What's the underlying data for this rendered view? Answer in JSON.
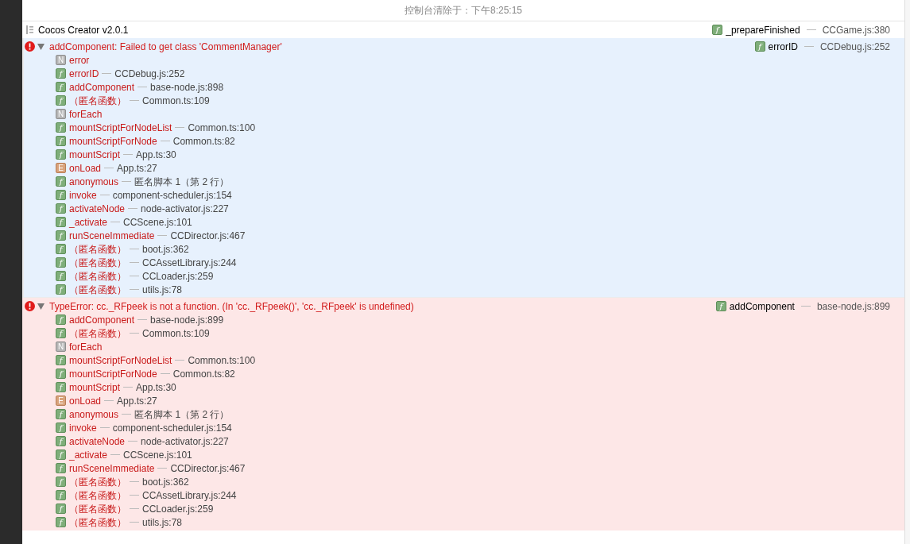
{
  "clear_notice": "控制台清除于：下午8:25:15",
  "messages": [
    {
      "kind": "log",
      "text": "Cocos Creator v2.0.1",
      "selected": false,
      "call_site": {
        "kind": "function",
        "badge": "f",
        "name": "_prepareFinished",
        "location": "CCGame.js:380"
      }
    },
    {
      "kind": "error",
      "text": "addComponent: Failed to get class 'CommentManager'",
      "selected": true,
      "expanded": true,
      "call_site": {
        "kind": "function",
        "badge": "f",
        "name": "errorID",
        "location": "CCDebug.js:252"
      },
      "frames": [
        {
          "kind": "native",
          "badge": "N",
          "name": "error"
        },
        {
          "kind": "function",
          "badge": "f",
          "name": "errorID",
          "location": "CCDebug.js:252"
        },
        {
          "kind": "function",
          "badge": "f",
          "name": "addComponent",
          "location": "base-node.js:898"
        },
        {
          "kind": "function",
          "badge": "f",
          "name": "（匿名函数）",
          "location": "Common.ts:109"
        },
        {
          "kind": "native",
          "badge": "N",
          "name": "forEach"
        },
        {
          "kind": "function",
          "badge": "f",
          "name": "mountScriptForNodeList",
          "location": "Common.ts:100"
        },
        {
          "kind": "function",
          "badge": "f",
          "name": "mountScriptForNode",
          "location": "Common.ts:82"
        },
        {
          "kind": "function",
          "badge": "f",
          "name": "mountScript",
          "location": "App.ts:30"
        },
        {
          "kind": "event",
          "badge": "E",
          "name": "onLoad",
          "location": "App.ts:27"
        },
        {
          "kind": "function",
          "badge": "f",
          "name": "anonymous",
          "location": "匿名脚本 1（第 2 行）"
        },
        {
          "kind": "function",
          "badge": "f",
          "name": "invoke",
          "location": "component-scheduler.js:154"
        },
        {
          "kind": "function",
          "badge": "f",
          "name": "activateNode",
          "location": "node-activator.js:227"
        },
        {
          "kind": "function",
          "badge": "f",
          "name": "_activate",
          "location": "CCScene.js:101"
        },
        {
          "kind": "function",
          "badge": "f",
          "name": "runSceneImmediate",
          "location": "CCDirector.js:467"
        },
        {
          "kind": "function",
          "badge": "f",
          "name": "（匿名函数）",
          "location": "boot.js:362"
        },
        {
          "kind": "function",
          "badge": "f",
          "name": "（匿名函数）",
          "location": "CCAssetLibrary.js:244"
        },
        {
          "kind": "function",
          "badge": "f",
          "name": "（匿名函数）",
          "location": "CCLoader.js:259"
        },
        {
          "kind": "function",
          "badge": "f",
          "name": "（匿名函数）",
          "location": "utils.js:78"
        }
      ]
    },
    {
      "kind": "error",
      "text": "TypeError: cc._RFpeek is not a function. (In 'cc._RFpeek()', 'cc._RFpeek' is undefined)",
      "selected": false,
      "expanded": true,
      "call_site": {
        "kind": "function",
        "badge": "f",
        "name": "addComponent",
        "location": "base-node.js:899"
      },
      "frames": [
        {
          "kind": "function",
          "badge": "f",
          "name": "addComponent",
          "location": "base-node.js:899"
        },
        {
          "kind": "function",
          "badge": "f",
          "name": "（匿名函数）",
          "location": "Common.ts:109"
        },
        {
          "kind": "native",
          "badge": "N",
          "name": "forEach"
        },
        {
          "kind": "function",
          "badge": "f",
          "name": "mountScriptForNodeList",
          "location": "Common.ts:100"
        },
        {
          "kind": "function",
          "badge": "f",
          "name": "mountScriptForNode",
          "location": "Common.ts:82"
        },
        {
          "kind": "function",
          "badge": "f",
          "name": "mountScript",
          "location": "App.ts:30"
        },
        {
          "kind": "event",
          "badge": "E",
          "name": "onLoad",
          "location": "App.ts:27"
        },
        {
          "kind": "function",
          "badge": "f",
          "name": "anonymous",
          "location": "匿名脚本 1（第 2 行）"
        },
        {
          "kind": "function",
          "badge": "f",
          "name": "invoke",
          "location": "component-scheduler.js:154"
        },
        {
          "kind": "function",
          "badge": "f",
          "name": "activateNode",
          "location": "node-activator.js:227"
        },
        {
          "kind": "function",
          "badge": "f",
          "name": "_activate",
          "location": "CCScene.js:101"
        },
        {
          "kind": "function",
          "badge": "f",
          "name": "runSceneImmediate",
          "location": "CCDirector.js:467"
        },
        {
          "kind": "function",
          "badge": "f",
          "name": "（匿名函数）",
          "location": "boot.js:362"
        },
        {
          "kind": "function",
          "badge": "f",
          "name": "（匿名函数）",
          "location": "CCAssetLibrary.js:244"
        },
        {
          "kind": "function",
          "badge": "f",
          "name": "（匿名函数）",
          "location": "CCLoader.js:259"
        },
        {
          "kind": "function",
          "badge": "f",
          "name": "（匿名函数）",
          "location": "utils.js:78"
        }
      ]
    }
  ]
}
